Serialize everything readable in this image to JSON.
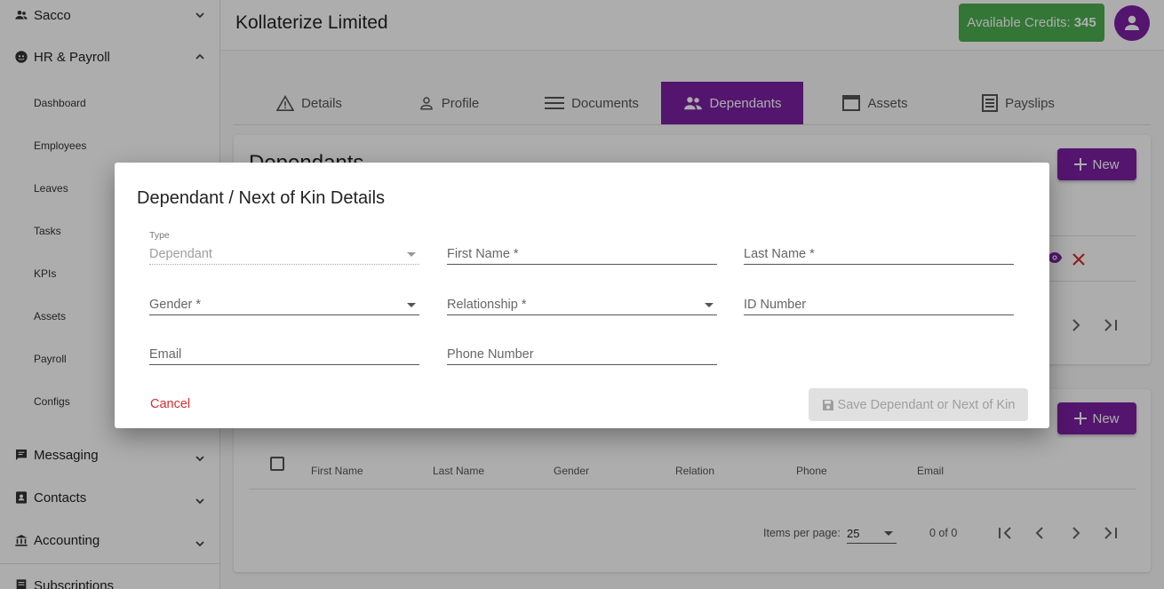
{
  "sidebar": {
    "sacco": "Sacco",
    "hr": "HR & Payroll",
    "sub": [
      "Dashboard",
      "Employees",
      "Leaves",
      "Tasks",
      "KPIs",
      "Assets",
      "Payroll",
      "Configs"
    ],
    "messaging": "Messaging",
    "contacts": "Contacts",
    "accounting": "Accounting",
    "subscriptions": "Subscriptions"
  },
  "header": {
    "company": "Kollaterize Limited",
    "credits_label": "Available Credits:",
    "credits_value": "345"
  },
  "tabs": [
    "Details",
    "Profile",
    "Documents",
    "Dependants",
    "Assets",
    "Payslips"
  ],
  "active_tab": "Dependants",
  "section": {
    "title": "Dependants",
    "new_label": "New"
  },
  "table": {
    "columns": [
      "First Name",
      "Last Name",
      "Gender",
      "Relation",
      "Phone",
      "Email"
    ],
    "items_per_page_label": "Items per page:",
    "items_per_page": "25",
    "range": "0 of 0"
  },
  "dialog": {
    "title": "Dependant / Next of Kin Details",
    "type_label": "Type",
    "type_value": "Dependant",
    "first_name": "First Name *",
    "last_name": "Last Name *",
    "gender": "Gender *",
    "relationship": "Relationship *",
    "id_number": "ID Number",
    "email": "Email",
    "phone": "Phone Number",
    "cancel": "Cancel",
    "save": "Save Dependant or Next of Kin"
  },
  "colors": {
    "primary": "#7b1fa2",
    "credits": "#4caf50",
    "danger": "#d32f2f"
  }
}
